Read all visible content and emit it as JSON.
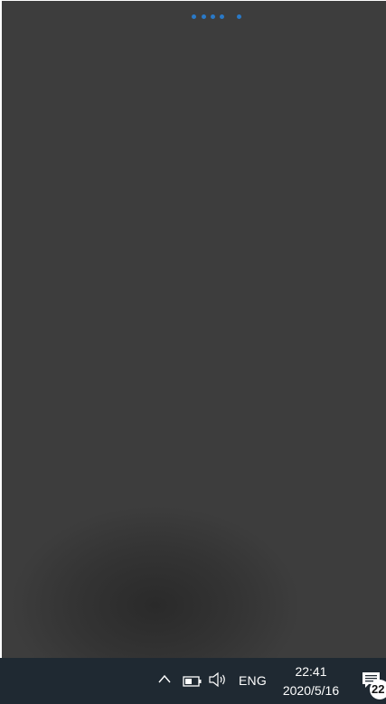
{
  "loading": {
    "indicator": "loading-dots-icon",
    "dot_count": 5,
    "color": "#2a79c7"
  },
  "taskbar": {
    "background": "#1f2932",
    "tray": {
      "show_hidden_icon": "chevron-up-icon",
      "battery_icon": "battery-icon",
      "volume_icon": "speaker-icon",
      "language": "ENG",
      "time": "22:41",
      "date": "2020/5/16",
      "notification_icon": "notification-icon",
      "notification_count": "22"
    }
  }
}
